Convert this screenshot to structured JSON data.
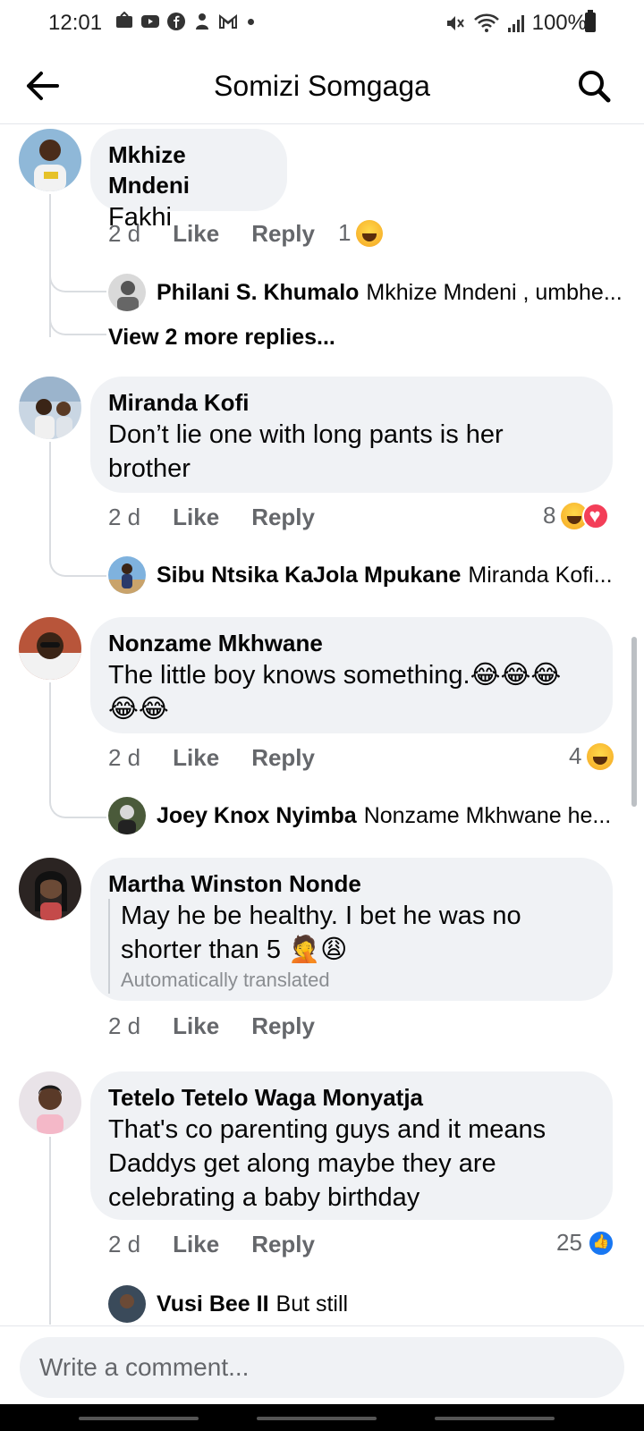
{
  "status_bar": {
    "time": "12:01",
    "battery": "100%",
    "notification_icons": [
      "message-icon",
      "youtube-icon",
      "facebook-icon",
      "app-icon",
      "gmail-icon"
    ]
  },
  "header": {
    "title": "Somizi Somgaga"
  },
  "comments": [
    {
      "name": "Mkhize Mndeni",
      "text": "Fakhi",
      "time": "2 d",
      "like": "Like",
      "reply": "Reply",
      "reaction_count": "1",
      "reactions": [
        "haha"
      ],
      "replies": [
        {
          "name": "Philani S. Khumalo",
          "text": "Mkhize Mndeni , umbhe..."
        }
      ],
      "more_replies": "View 2 more replies..."
    },
    {
      "name": "Miranda Kofi",
      "text_lines": [
        "Don’t lie one with long pants is her",
        "brother"
      ],
      "time": "2 d",
      "like": "Like",
      "reply": "Reply",
      "reaction_count": "8",
      "reactions": [
        "haha",
        "love"
      ],
      "replies": [
        {
          "name": "Sibu Ntsika KaJola Mpukane",
          "text": "Miranda Kofi..."
        }
      ]
    },
    {
      "name": "Nonzame Mkhwane",
      "text_lines": [
        "The little boy knows something.😂😂😂",
        "😂😂"
      ],
      "time": "2 d",
      "like": "Like",
      "reply": "Reply",
      "reaction_count": "4",
      "reactions": [
        "haha"
      ],
      "replies": [
        {
          "name": "Joey Knox Nyimba",
          "text": "Nonzame Mkhwane he..."
        }
      ]
    },
    {
      "name": "Martha Winston Nonde",
      "text_lines": [
        "May he be healthy. I bet he was no",
        "shorter than 5 🤦😩"
      ],
      "translated_note": "Automatically translated",
      "time": "2 d",
      "like": "Like",
      "reply": "Reply"
    },
    {
      "name": "Tetelo Tetelo Waga Monyatja",
      "text_lines": [
        "That's co parenting guys and it means",
        "Daddys get along maybe they are",
        "celebrating a baby birthday"
      ],
      "time": "2 d",
      "like": "Like",
      "reply": "Reply",
      "reaction_count": "25",
      "reactions": [
        "like"
      ],
      "replies": [
        {
          "name": "Vusi Bee II",
          "text": "But still"
        }
      ]
    }
  ],
  "composer": {
    "placeholder": "Write a comment..."
  },
  "colors": {
    "bubble": "#f0f2f5",
    "meta_text": "#65676b",
    "like_blue": "#1877f2",
    "love_red": "#f33e58",
    "haha_yellow": "#f7b928"
  }
}
